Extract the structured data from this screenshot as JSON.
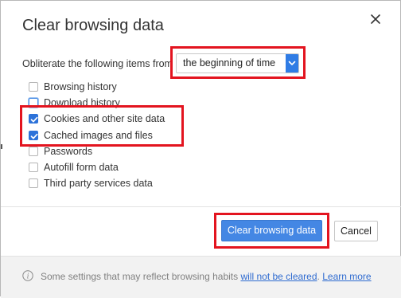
{
  "dialog": {
    "title": "Clear browsing data",
    "close_icon": "close-icon"
  },
  "range": {
    "label": "Obliterate the following items from",
    "selected": "the beginning of time",
    "arrow_icon": "chevron-down-icon"
  },
  "options": [
    {
      "label": "Browsing history",
      "checked": false
    },
    {
      "label": "Download history",
      "checked": false
    },
    {
      "label": "Cookies and other site data",
      "checked": true
    },
    {
      "label": "Cached images and files",
      "checked": true
    },
    {
      "label": "Passwords",
      "checked": false
    },
    {
      "label": "Autofill form data",
      "checked": false
    },
    {
      "label": "Third party services data",
      "checked": false
    }
  ],
  "buttons": {
    "clear": "Clear browsing data",
    "cancel": "Cancel"
  },
  "footer": {
    "icon": "info-icon",
    "text": "Some settings that may reflect browsing habits",
    "link1": "will not be cleared",
    "period": ".",
    "link2": "Learn more"
  },
  "colors": {
    "accent": "#4487e4",
    "highlight": "#e3141f",
    "checkbox_checked": "#2c72d9"
  }
}
